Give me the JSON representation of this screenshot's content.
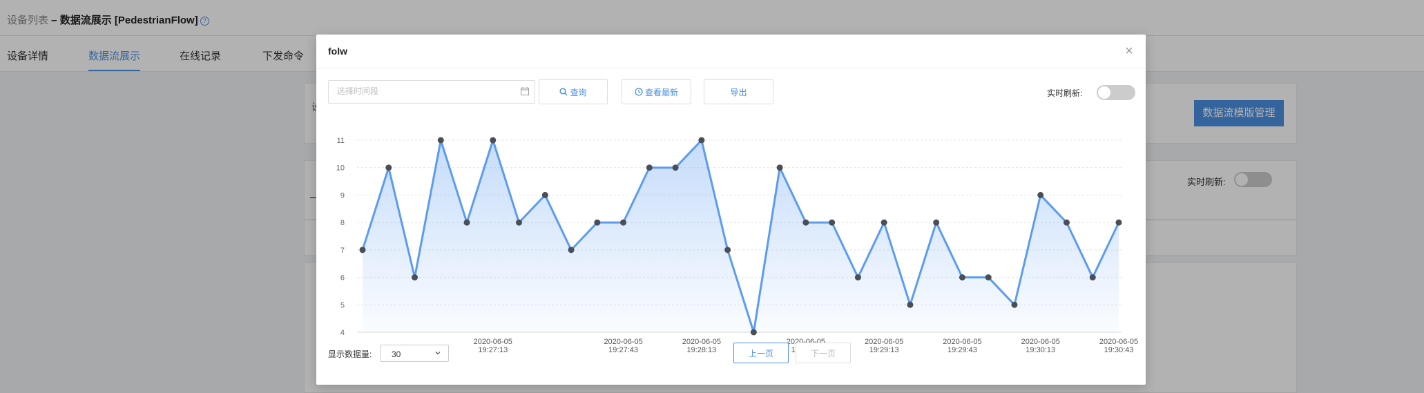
{
  "header": {
    "breadcrumb_parent": "设备列表",
    "breadcrumb_sep": " – ",
    "breadcrumb_current": "数据流展示 [PedestrianFlow]",
    "help_icon": "?"
  },
  "tabs": [
    {
      "label": "设备详情"
    },
    {
      "label": "数据流展示"
    },
    {
      "label": "在线记录"
    },
    {
      "label": "下发命令"
    }
  ],
  "background": {
    "card_text": "设",
    "manage_button": "数据流模版管理",
    "realtime_label": "实时刷新:"
  },
  "modal": {
    "title": "folw",
    "close_icon": "×",
    "time_placeholder": "选择时间段",
    "query_label": "查询",
    "latest_label": "查看最新",
    "export_label": "导出",
    "realtime_label": "实时刷新:",
    "realtime_on": false,
    "show_count_label": "显示数据量:",
    "show_count_value": "30",
    "prev_label": "上一页",
    "next_label": "下一页"
  },
  "colors": {
    "accent": "#4a90e2",
    "line": "#5b9cf0",
    "point": "#4a4f57"
  },
  "chart_data": {
    "type": "area",
    "title": "",
    "xlabel": "",
    "ylabel": "",
    "ylim": [
      4,
      11
    ],
    "yticks": [
      4,
      5,
      6,
      7,
      8,
      9,
      10,
      11
    ],
    "x": [
      "2020-06-05 19:26:28",
      "2020-06-05 19:26:33",
      "2020-06-05 19:26:48",
      "2020-06-05 19:26:58",
      "2020-06-05 19:27:03",
      "2020-06-05 19:27:13",
      "2020-06-05 19:27:18",
      "2020-06-05 19:27:28",
      "2020-06-05 19:27:33",
      "2020-06-05 19:27:38",
      "2020-06-05 19:27:43",
      "2020-06-05 19:27:58",
      "2020-06-05 19:28:08",
      "2020-06-05 19:28:13",
      "2020-06-05 19:28:23",
      "2020-06-05 19:28:33",
      "2020-06-05 19:28:38",
      "2020-06-05 19:28:43",
      "2020-06-05 19:28:53",
      "2020-06-05 19:29:03",
      "2020-06-05 19:29:13",
      "2020-06-05 19:29:18",
      "2020-06-05 19:29:33",
      "2020-06-05 19:29:43",
      "2020-06-05 19:29:53",
      "2020-06-05 19:30:03",
      "2020-06-05 19:30:13",
      "2020-06-05 19:30:23",
      "2020-06-05 19:30:33",
      "2020-06-05 19:30:43"
    ],
    "values": [
      7,
      10,
      6,
      11,
      8,
      11,
      8,
      9,
      7,
      8,
      8,
      10,
      10,
      11,
      7,
      4,
      10,
      8,
      8,
      6,
      8,
      5,
      8,
      6,
      6,
      5,
      9,
      8,
      6,
      8
    ],
    "xtick_labels": [
      {
        "date": "2020-06-05",
        "time": "19:27:13"
      },
      {
        "date": "2020-06-05",
        "time": "19:27:43"
      },
      {
        "date": "2020-06-05",
        "time": "19:28:13"
      },
      {
        "date": "2020-06-05",
        "time": "19:28:43"
      },
      {
        "date": "2020-06-05",
        "time": "19:29:13"
      },
      {
        "date": "2020-06-05",
        "time": "19:29:43"
      },
      {
        "date": "2020-06-05",
        "time": "19:30:13"
      },
      {
        "date": "2020-06-05",
        "time": "19:30:43"
      }
    ],
    "grid": true,
    "legend": "none"
  }
}
